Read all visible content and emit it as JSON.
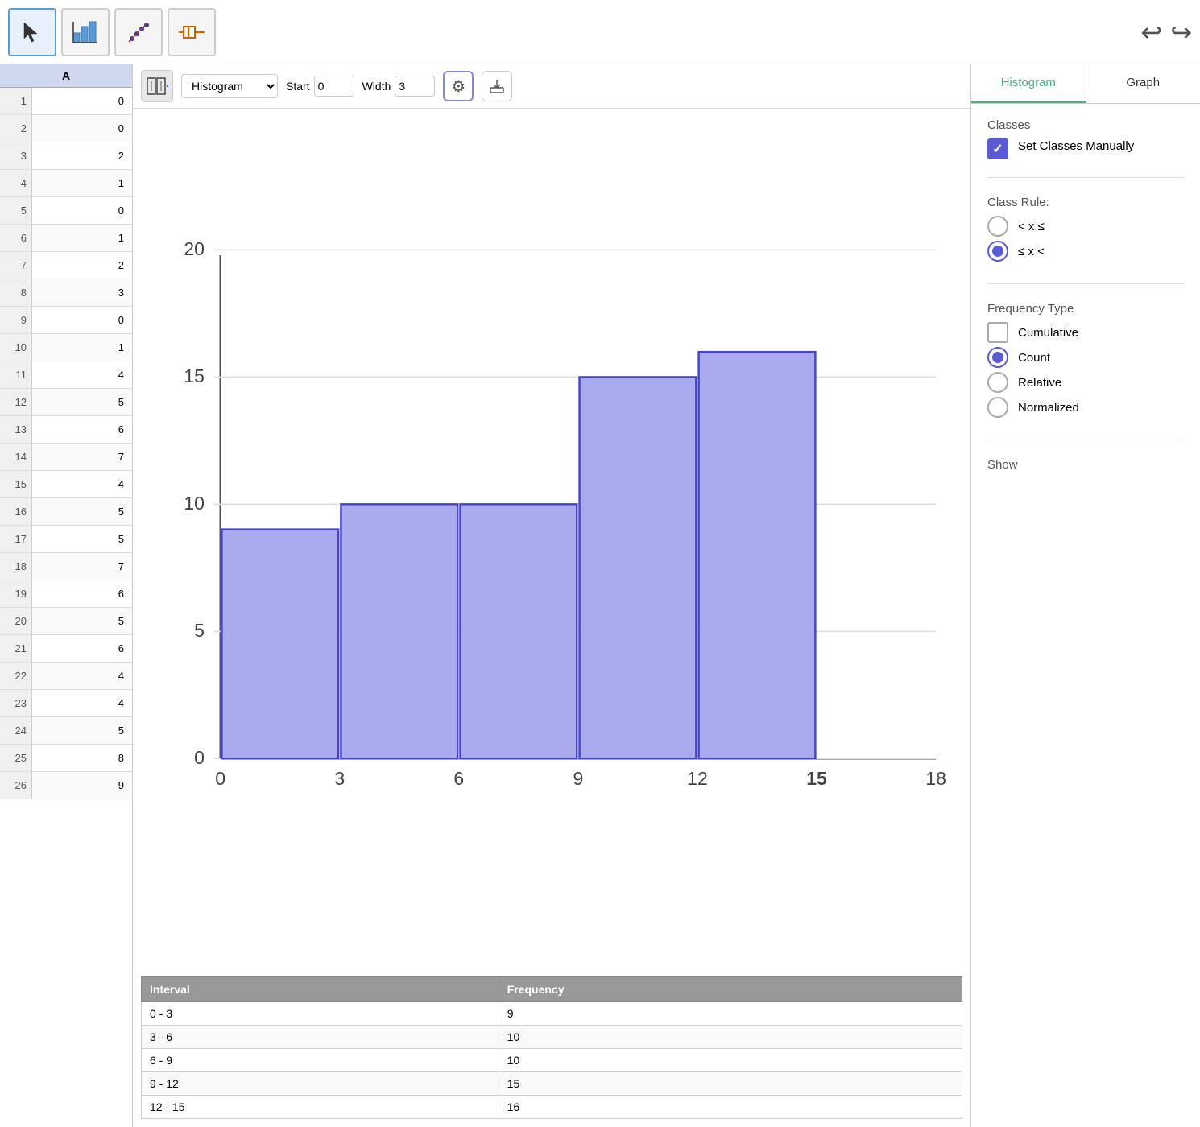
{
  "toolbar": {
    "undo_label": "↩",
    "redo_label": "↪",
    "tools": [
      {
        "id": "select",
        "icon": "↖",
        "active": true
      },
      {
        "id": "bar-chart",
        "icon": "📊",
        "active": false
      },
      {
        "id": "scatter",
        "icon": "⋮",
        "active": false
      },
      {
        "id": "box",
        "icon": "⊟",
        "active": false
      }
    ]
  },
  "spreadsheet": {
    "col_header": "A",
    "rows": [
      {
        "num": 1,
        "val": 0
      },
      {
        "num": 2,
        "val": 0
      },
      {
        "num": 3,
        "val": 2
      },
      {
        "num": 4,
        "val": 1
      },
      {
        "num": 5,
        "val": 0
      },
      {
        "num": 6,
        "val": 1
      },
      {
        "num": 7,
        "val": 2
      },
      {
        "num": 8,
        "val": 3
      },
      {
        "num": 9,
        "val": 0
      },
      {
        "num": 10,
        "val": 1
      },
      {
        "num": 11,
        "val": 4
      },
      {
        "num": 12,
        "val": 5
      },
      {
        "num": 13,
        "val": 6
      },
      {
        "num": 14,
        "val": 7
      },
      {
        "num": 15,
        "val": 4
      },
      {
        "num": 16,
        "val": 5
      },
      {
        "num": 17,
        "val": 5
      },
      {
        "num": 18,
        "val": 7
      },
      {
        "num": 19,
        "val": 6
      },
      {
        "num": 20,
        "val": 5
      },
      {
        "num": 21,
        "val": 6
      },
      {
        "num": 22,
        "val": 4
      },
      {
        "num": 23,
        "val": 4
      },
      {
        "num": 24,
        "val": 5
      },
      {
        "num": 25,
        "val": 8
      },
      {
        "num": 26,
        "val": 9
      }
    ]
  },
  "chart": {
    "type": "Histogram",
    "start_label": "Start",
    "start_value": "0",
    "width_label": "Width",
    "width_value": "3",
    "x_labels": [
      "0",
      "3",
      "6",
      "9",
      "12",
      "15",
      "18"
    ],
    "y_labels": [
      "0",
      "5",
      "10",
      "15",
      "20"
    ],
    "bars": [
      {
        "interval": "0-3",
        "height": 9,
        "label": "0-3"
      },
      {
        "interval": "3-6",
        "height": 10,
        "label": "3-6"
      },
      {
        "interval": "6-9",
        "height": 10,
        "label": "6-9"
      },
      {
        "interval": "9-12",
        "height": 15,
        "label": "9-12"
      },
      {
        "interval": "12-15",
        "height": 16,
        "label": "12-15"
      }
    ],
    "max_y": 20
  },
  "freq_table": {
    "col1_header": "Interval",
    "col2_header": "Frequency",
    "rows": [
      {
        "interval": "0 - 3",
        "frequency": "9"
      },
      {
        "interval": "3 - 6",
        "frequency": "10"
      },
      {
        "interval": "6 - 9",
        "frequency": "10"
      },
      {
        "interval": "9 - 12",
        "frequency": "15"
      },
      {
        "interval": "12 - 15",
        "frequency": "16"
      }
    ]
  },
  "right_panel": {
    "tab_histogram": "Histogram",
    "tab_graph": "Graph",
    "classes_title": "Classes",
    "set_classes_label": "Set Classes Manually",
    "class_rule_title": "Class Rule:",
    "rule1": "< x ≤",
    "rule2": "≤ x <",
    "freq_type_title": "Frequency Type",
    "cumulative_label": "Cumulative",
    "count_label": "Count",
    "relative_label": "Relative",
    "normalized_label": "Normalized",
    "show_title": "Show"
  }
}
